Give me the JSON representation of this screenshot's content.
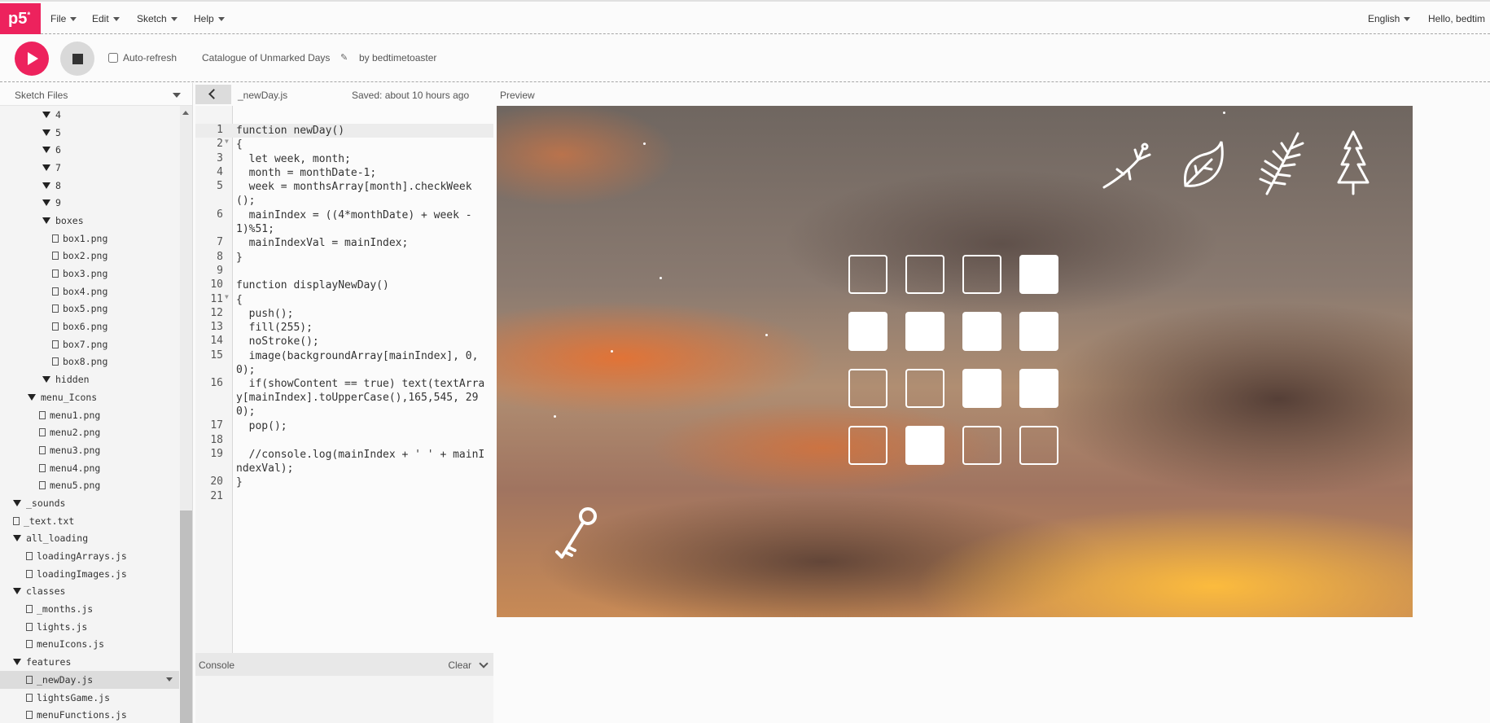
{
  "topbar": {
    "logo": "p5",
    "logo_sup": "*",
    "menus": [
      {
        "label": "File"
      },
      {
        "label": "Edit"
      },
      {
        "label": "Sketch"
      },
      {
        "label": "Help"
      }
    ],
    "language": "English",
    "greeting": "Hello, bedtim"
  },
  "toolbar": {
    "auto_refresh_label": "Auto-refresh",
    "auto_refresh_checked": false,
    "sketch_name": "Catalogue of Unmarked Days",
    "byline": "by bedtimetoaster"
  },
  "sidebar": {
    "header": "Sketch Files",
    "items": [
      {
        "label": "4",
        "type": "folder",
        "depth": 2
      },
      {
        "label": "5",
        "type": "folder",
        "depth": 2
      },
      {
        "label": "6",
        "type": "folder",
        "depth": 2
      },
      {
        "label": "7",
        "type": "folder",
        "depth": 2
      },
      {
        "label": "8",
        "type": "folder",
        "depth": 2
      },
      {
        "label": "9",
        "type": "folder",
        "depth": 2
      },
      {
        "label": "boxes",
        "type": "folder",
        "depth": 2
      },
      {
        "label": "box1.png",
        "type": "file",
        "depth": 3
      },
      {
        "label": "box2.png",
        "type": "file",
        "depth": 3
      },
      {
        "label": "box3.png",
        "type": "file",
        "depth": 3
      },
      {
        "label": "box4.png",
        "type": "file",
        "depth": 3
      },
      {
        "label": "box5.png",
        "type": "file",
        "depth": 3
      },
      {
        "label": "box6.png",
        "type": "file",
        "depth": 3
      },
      {
        "label": "box7.png",
        "type": "file",
        "depth": 3
      },
      {
        "label": "box8.png",
        "type": "file",
        "depth": 3
      },
      {
        "label": "hidden",
        "type": "folder",
        "depth": 2
      },
      {
        "label": "menu_Icons",
        "type": "folder",
        "depth": 1
      },
      {
        "label": "menu1.png",
        "type": "file",
        "depth": 2
      },
      {
        "label": "menu2.png",
        "type": "file",
        "depth": 2
      },
      {
        "label": "menu3.png",
        "type": "file",
        "depth": 2
      },
      {
        "label": "menu4.png",
        "type": "file",
        "depth": 2
      },
      {
        "label": "menu5.png",
        "type": "file",
        "depth": 2
      },
      {
        "label": "_sounds",
        "type": "folder",
        "depth": 0
      },
      {
        "label": "_text.txt",
        "type": "file",
        "depth": 0
      },
      {
        "label": "all_loading",
        "type": "folder",
        "depth": 0
      },
      {
        "label": "loadingArrays.js",
        "type": "file",
        "depth": 1
      },
      {
        "label": "loadingImages.js",
        "type": "file",
        "depth": 1
      },
      {
        "label": "classes",
        "type": "folder",
        "depth": 0
      },
      {
        "label": "_months.js",
        "type": "file",
        "depth": 1
      },
      {
        "label": "lights.js",
        "type": "file",
        "depth": 1
      },
      {
        "label": "menuIcons.js",
        "type": "file",
        "depth": 1
      },
      {
        "label": "features",
        "type": "folder",
        "depth": 0
      },
      {
        "label": "_newDay.js",
        "type": "file",
        "depth": 1,
        "selected": true
      },
      {
        "label": "lightsGame.js",
        "type": "file",
        "depth": 1
      },
      {
        "label": "menuFunctions.js",
        "type": "file",
        "depth": 1
      }
    ]
  },
  "editor": {
    "file_name": "_newDay.js",
    "saved_status": "Saved: about 10 hours ago",
    "lines": [
      {
        "n": "1",
        "fold": "",
        "text": "function newDay()",
        "rows": 1
      },
      {
        "n": "2",
        "fold": "▼",
        "text": "{",
        "rows": 1
      },
      {
        "n": "3",
        "fold": "",
        "text": "  let week, month;",
        "rows": 1
      },
      {
        "n": "4",
        "fold": "",
        "text": "  month = monthDate-1;",
        "rows": 1
      },
      {
        "n": "5",
        "fold": "",
        "text": "  week = monthsArray[month].checkWeek();",
        "rows": 2
      },
      {
        "n": "6",
        "fold": "",
        "text": "  mainIndex = ((4*monthDate) + week - 1)%51;",
        "rows": 2
      },
      {
        "n": "7",
        "fold": "",
        "text": "  mainIndexVal = mainIndex;",
        "rows": 1
      },
      {
        "n": "8",
        "fold": "",
        "text": "}",
        "rows": 1
      },
      {
        "n": "9",
        "fold": "",
        "text": "",
        "rows": 1
      },
      {
        "n": "10",
        "fold": "",
        "text": "function displayNewDay()",
        "rows": 1
      },
      {
        "n": "11",
        "fold": "▼",
        "text": "{",
        "rows": 1
      },
      {
        "n": "12",
        "fold": "",
        "text": "  push();",
        "rows": 1
      },
      {
        "n": "13",
        "fold": "",
        "text": "  fill(255);",
        "rows": 1
      },
      {
        "n": "14",
        "fold": "",
        "text": "  noStroke();",
        "rows": 1
      },
      {
        "n": "15",
        "fold": "",
        "text": "  image(backgroundArray[mainIndex], 0,0);",
        "rows": 2
      },
      {
        "n": "16",
        "fold": "",
        "text": "  if(showContent == true) text(textArray[mainIndex].toUpperCase(),165,545, 290);",
        "rows": 3
      },
      {
        "n": "17",
        "fold": "",
        "text": "  pop();",
        "rows": 1
      },
      {
        "n": "18",
        "fold": "",
        "text": "",
        "rows": 1
      },
      {
        "n": "19",
        "fold": "",
        "text": "  //console.log(mainIndex + ' ' + mainIndexVal);",
        "rows": 2
      },
      {
        "n": "20",
        "fold": "",
        "text": "}",
        "rows": 1
      },
      {
        "n": "21",
        "fold": "",
        "text": "",
        "rows": 1
      }
    ]
  },
  "console": {
    "label": "Console",
    "clear_label": "Clear"
  },
  "preview": {
    "label": "Preview",
    "menu_icons": [
      "flower-sprig-icon",
      "leaf-icon",
      "fern-icon",
      "pine-tree-icon"
    ],
    "key_icon": "key-icon",
    "boxes": [
      false,
      false,
      false,
      true,
      true,
      true,
      true,
      true,
      false,
      false,
      true,
      true,
      false,
      true,
      false,
      false
    ]
  }
}
